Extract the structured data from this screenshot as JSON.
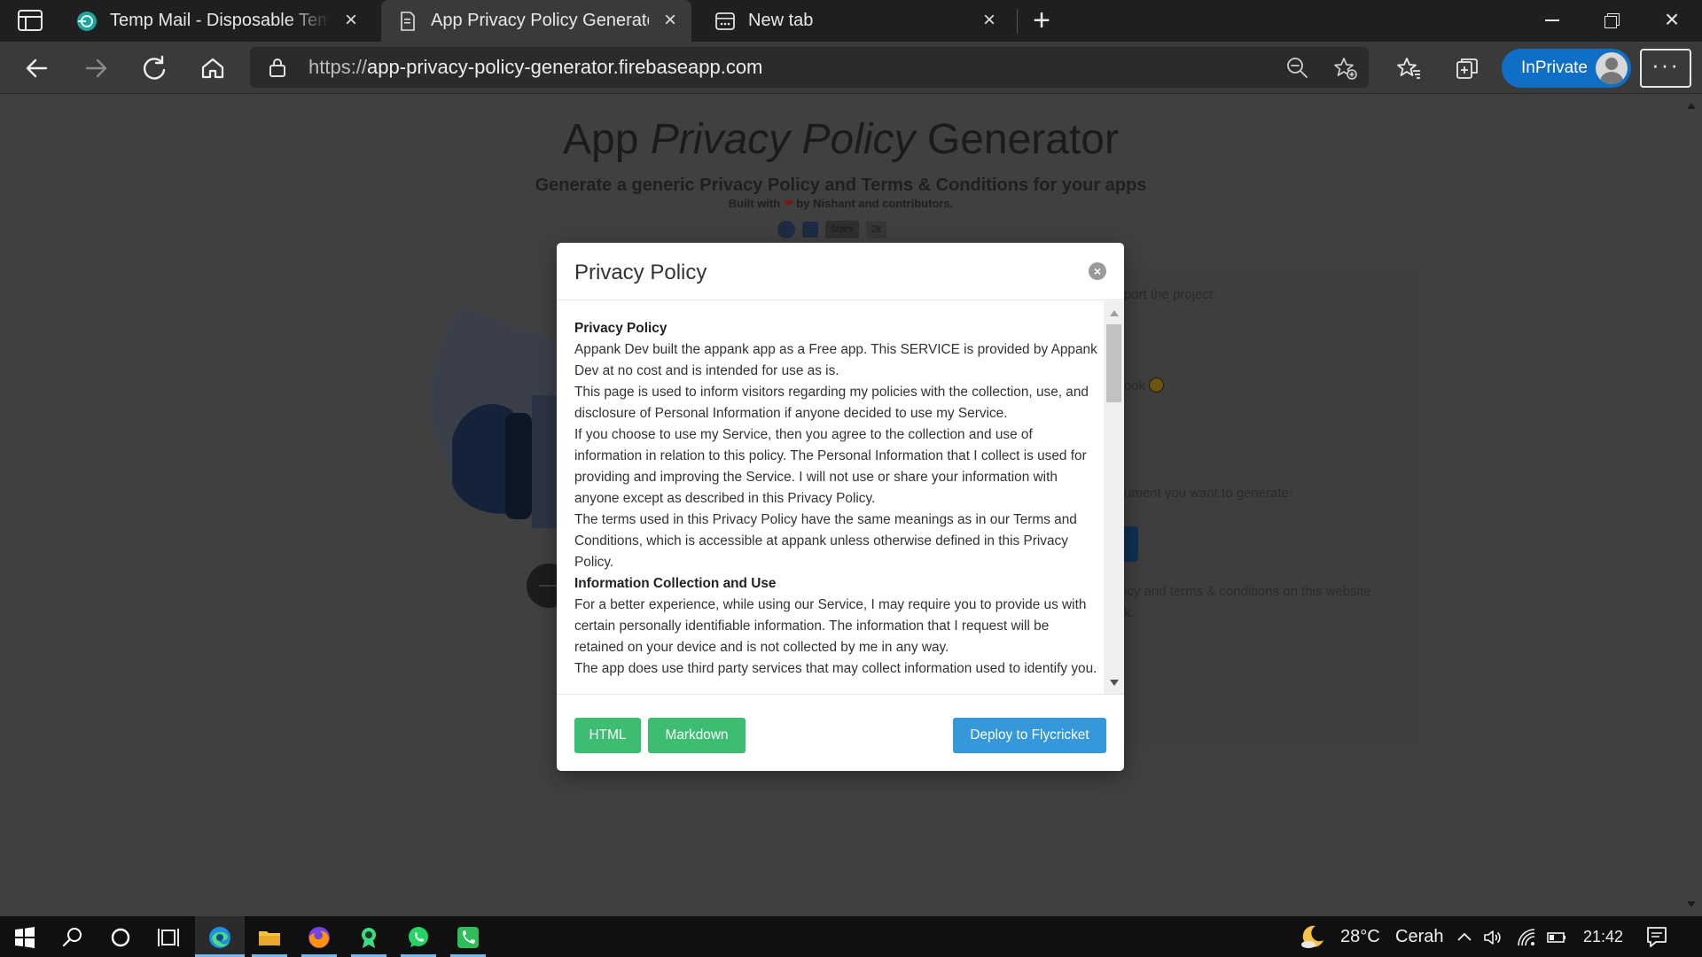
{
  "browser": {
    "tabs": [
      {
        "title": "Temp Mail - Disposable Temporary Email",
        "active": false
      },
      {
        "title": "App Privacy Policy Generator",
        "active": true
      },
      {
        "title": "New tab",
        "active": false
      }
    ],
    "url_protocol": "https://",
    "url_host": "app-privacy-policy-generator.firebaseapp.com",
    "inprivate_label": "InPrivate",
    "more_label": "···",
    "accent_color": "#0f6fc6"
  },
  "page": {
    "title_pre": "App ",
    "title_em": "Privacy Policy",
    "title_post": " Generator",
    "subtitle": "Generate a generic Privacy Policy and Terms & Conditions for your apps",
    "built_pre": "Built with ",
    "built_heart": "❤",
    "built_post": " by Nishant and contributors.",
    "badge_stars": "Stars",
    "badge_count": "2k",
    "bg_support": "port the project:",
    "bg_book": "ook",
    "bg_document": "ument you want to generate:",
    "bg_note1": "icy and terms & conditions on this website",
    "bg_note2": "k."
  },
  "modal": {
    "title": "Privacy Policy",
    "close_label": "×",
    "heading1": "Privacy Policy",
    "p1": "Appank Dev built the appank app as a Free app. This SERVICE is provided by Appank Dev at no cost and is intended for use as is.",
    "p2": "This page is used to inform visitors regarding my policies with the collection, use, and disclosure of Personal Information if anyone decided to use my Service.",
    "p3": "If you choose to use my Service, then you agree to the collection and use of information in relation to this policy. The Personal Information that I collect is used for providing and improving the Service. I will not use or share your information with anyone except as described in this Privacy Policy.",
    "p4": "The terms used in this Privacy Policy have the same meanings as in our Terms and Conditions, which is accessible at appank unless otherwise defined in this Privacy Policy.",
    "heading2": "Information Collection and Use",
    "p5": "For a better experience, while using our Service, I may require you to provide us with certain personally identifiable information. The information that I request will be retained on your device and is not collected by me in any way.",
    "p6": "The app does use third party services that may collect information used to identify you.",
    "btn_html": "HTML",
    "btn_markdown": "Markdown",
    "btn_deploy": "Deploy to Flycricket",
    "green_color": "#3cbd72",
    "blue_color": "#3498db"
  },
  "taskbar": {
    "temperature": "28°C",
    "weather": "Cerah",
    "time": "21:42"
  }
}
